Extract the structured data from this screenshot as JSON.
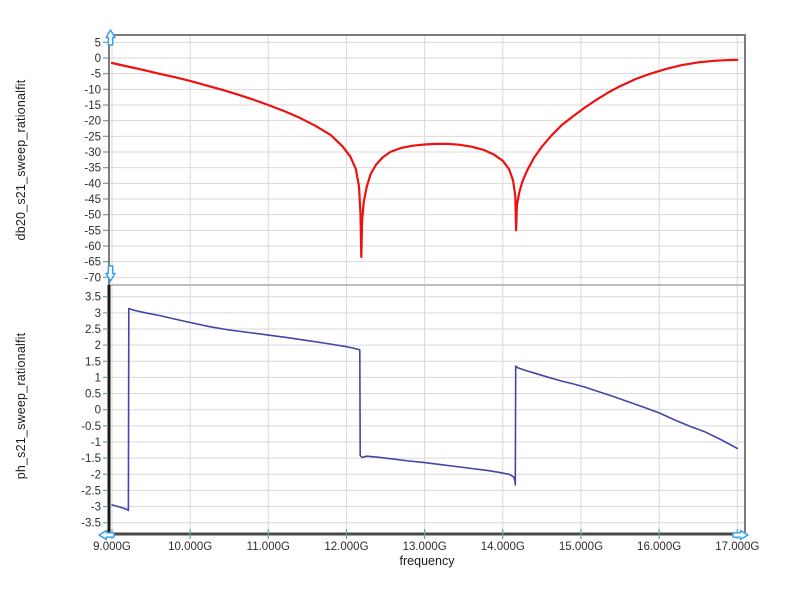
{
  "figure": {
    "background": "#ffffff",
    "x_axis": {
      "label": "frequency",
      "tick_labels": [
        "9.000G",
        "10.000G",
        "11.000G",
        "12.000G",
        "13.000G",
        "14.000G",
        "15.000G",
        "16.000G",
        "17.000G"
      ],
      "tick_values": [
        9,
        10,
        11,
        12,
        13,
        14,
        15,
        16,
        17
      ]
    },
    "colors": {
      "grid": "#d9d9d9",
      "frame": "#7b7b7b",
      "axis_left_dark": "#1a1a1a",
      "axis_bottom_dark": "#4a4a4a",
      "tick": "#5ba7ad",
      "tick_label": "#2e2e2e",
      "handle_stroke": "#3b9de8",
      "handle_fill": "#f2faff",
      "trace_db20": "#ee1111",
      "trace_phase": "#4345a8"
    },
    "handles": [
      {
        "name": "y-axis-scale-up-handle-icon",
        "direction": "up"
      },
      {
        "name": "y-axis-scale-down-handle-icon",
        "direction": "down"
      },
      {
        "name": "x-axis-scale-left-handle-icon",
        "direction": "left"
      },
      {
        "name": "x-axis-scale-right-handle-icon",
        "direction": "right"
      }
    ]
  },
  "chart_data": [
    {
      "type": "line",
      "title": "",
      "ylabel": "db20_s21_sweep_rationalfit",
      "xlabel": "frequency",
      "xlim": [
        9,
        17
      ],
      "ylim": [
        -70,
        5
      ],
      "grid": true,
      "legend": "none",
      "y_ticks": [
        5,
        0,
        -5,
        -10,
        -15,
        -20,
        -25,
        -30,
        -35,
        -40,
        -45,
        -50,
        -55,
        -60,
        -65,
        -70
      ],
      "y_tick_labels": [
        "5",
        "0",
        "-5",
        "-10",
        "-15",
        "-20",
        "-25",
        "-30",
        "-35",
        "-40",
        "-45",
        "-50",
        "-55",
        "-60",
        "-65",
        "-70"
      ],
      "x_tick_labels": [
        "9.000G",
        "10.000G",
        "11.000G",
        "12.000G",
        "13.000G",
        "14.000G",
        "15.000G",
        "16.000G",
        "17.000G"
      ],
      "series": [
        {
          "name": "db20_s21_sweep_rationalfit",
          "color": "#ee1111",
          "points": [
            [
              9.0,
              -1.6
            ],
            [
              9.2,
              -2.7
            ],
            [
              9.4,
              -3.8
            ],
            [
              9.6,
              -5.0
            ],
            [
              9.8,
              -6.1
            ],
            [
              10.0,
              -7.3
            ],
            [
              10.2,
              -8.7
            ],
            [
              10.4,
              -10.1
            ],
            [
              10.6,
              -11.6
            ],
            [
              10.8,
              -13.2
            ],
            [
              11.0,
              -15.0
            ],
            [
              11.2,
              -16.9
            ],
            [
              11.4,
              -19.1
            ],
            [
              11.6,
              -21.6
            ],
            [
              11.8,
              -24.6
            ],
            [
              11.95,
              -28.2
            ],
            [
              12.05,
              -31.5
            ],
            [
              12.12,
              -35.5
            ],
            [
              12.16,
              -41
            ],
            [
              12.18,
              -50
            ],
            [
              12.19,
              -63.5
            ],
            [
              12.2,
              -52
            ],
            [
              12.22,
              -46
            ],
            [
              12.26,
              -41
            ],
            [
              12.31,
              -37
            ],
            [
              12.38,
              -34
            ],
            [
              12.46,
              -31.8
            ],
            [
              12.56,
              -30
            ],
            [
              12.7,
              -28.7
            ],
            [
              12.85,
              -28.0
            ],
            [
              13.0,
              -27.6
            ],
            [
              13.15,
              -27.4
            ],
            [
              13.3,
              -27.4
            ],
            [
              13.45,
              -27.7
            ],
            [
              13.6,
              -28.3
            ],
            [
              13.75,
              -29.3
            ],
            [
              13.88,
              -30.7
            ],
            [
              14.0,
              -32.8
            ],
            [
              14.08,
              -35.5
            ],
            [
              14.13,
              -39
            ],
            [
              14.16,
              -44
            ],
            [
              14.17,
              -55
            ],
            [
              14.18,
              -47
            ],
            [
              14.21,
              -43
            ],
            [
              14.25,
              -39.5
            ],
            [
              14.31,
              -36
            ],
            [
              14.4,
              -31.8
            ],
            [
              14.5,
              -28.3
            ],
            [
              14.62,
              -24.8
            ],
            [
              14.75,
              -21.5
            ],
            [
              14.9,
              -18.6
            ],
            [
              15.05,
              -15.8
            ],
            [
              15.2,
              -13.3
            ],
            [
              15.35,
              -11.0
            ],
            [
              15.5,
              -9.0
            ],
            [
              15.7,
              -6.7
            ],
            [
              15.9,
              -4.9
            ],
            [
              16.1,
              -3.4
            ],
            [
              16.3,
              -2.2
            ],
            [
              16.5,
              -1.4
            ],
            [
              16.7,
              -0.9
            ],
            [
              16.85,
              -0.7
            ],
            [
              17.0,
              -0.6
            ]
          ]
        }
      ]
    },
    {
      "type": "line",
      "title": "",
      "ylabel": "ph_s21_sweep_rationalfit",
      "xlabel": "frequency",
      "xlim": [
        9,
        17
      ],
      "ylim": [
        -3.5,
        3.5
      ],
      "grid": true,
      "legend": "none",
      "y_ticks": [
        3.5,
        3,
        2.5,
        2,
        1.5,
        1,
        0.5,
        0,
        -0.5,
        -1,
        -1.5,
        -2,
        -2.5,
        -3,
        -3.5
      ],
      "y_tick_labels": [
        "3.5",
        "3",
        "2.5",
        "2",
        "1.5",
        "1",
        "0.5",
        "0",
        "-0.5",
        "-1",
        "-1.5",
        "-2",
        "-2.5",
        "-3",
        "-3.5"
      ],
      "x_tick_labels": [
        "9.000G",
        "10.000G",
        "11.000G",
        "12.000G",
        "13.000G",
        "14.000G",
        "15.000G",
        "16.000G",
        "17.000G"
      ],
      "series": [
        {
          "name": "ph_s21_sweep_rationalfit",
          "color": "#4345a8",
          "points": [
            [
              9.0,
              -2.95
            ],
            [
              9.08,
              -3.0
            ],
            [
              9.15,
              -3.05
            ],
            [
              9.2,
              -3.1
            ],
            [
              9.21,
              -3.12
            ],
            [
              9.215,
              3.13
            ],
            [
              9.3,
              3.07
            ],
            [
              9.45,
              2.99
            ],
            [
              9.6,
              2.92
            ],
            [
              9.8,
              2.81
            ],
            [
              10.0,
              2.7
            ],
            [
              10.25,
              2.57
            ],
            [
              10.5,
              2.47
            ],
            [
              10.75,
              2.39
            ],
            [
              11.0,
              2.31
            ],
            [
              11.25,
              2.23
            ],
            [
              11.5,
              2.14
            ],
            [
              11.75,
              2.05
            ],
            [
              12.0,
              1.95
            ],
            [
              12.1,
              1.9
            ],
            [
              12.16,
              1.86
            ],
            [
              12.17,
              1.85
            ],
            [
              12.175,
              -1.42
            ],
            [
              12.2,
              -1.48
            ],
            [
              12.26,
              -1.44
            ],
            [
              12.4,
              -1.47
            ],
            [
              12.6,
              -1.53
            ],
            [
              12.8,
              -1.59
            ],
            [
              13.0,
              -1.64
            ],
            [
              13.2,
              -1.7
            ],
            [
              13.4,
              -1.76
            ],
            [
              13.6,
              -1.82
            ],
            [
              13.8,
              -1.88
            ],
            [
              13.95,
              -1.94
            ],
            [
              14.08,
              -2.0
            ],
            [
              14.14,
              -2.08
            ],
            [
              14.155,
              -2.2
            ],
            [
              14.16,
              -2.33
            ],
            [
              14.165,
              1.35
            ],
            [
              14.19,
              1.3
            ],
            [
              14.3,
              1.21
            ],
            [
              14.45,
              1.1
            ],
            [
              14.6,
              0.99
            ],
            [
              14.75,
              0.89
            ],
            [
              14.9,
              0.8
            ],
            [
              15.05,
              0.7
            ],
            [
              15.2,
              0.58
            ],
            [
              15.4,
              0.42
            ],
            [
              15.6,
              0.25
            ],
            [
              15.8,
              0.08
            ],
            [
              16.0,
              -0.1
            ],
            [
              16.2,
              -0.32
            ],
            [
              16.4,
              -0.52
            ],
            [
              16.6,
              -0.7
            ],
            [
              16.8,
              -0.94
            ],
            [
              17.0,
              -1.2
            ]
          ]
        }
      ]
    }
  ]
}
